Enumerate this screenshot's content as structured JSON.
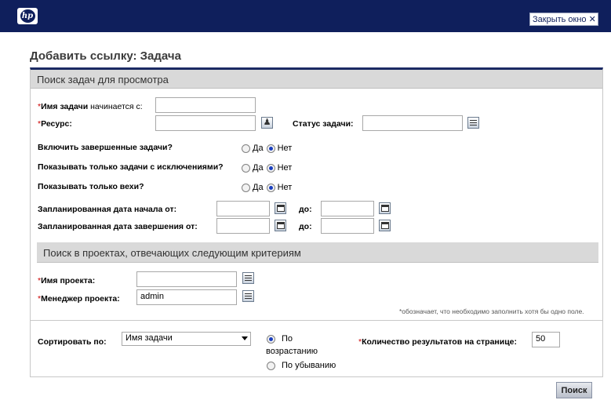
{
  "header": {
    "logo_text": "hp",
    "close_label": "Закрыть окно ✕"
  },
  "page_title": "Добавить ссылку: Задача",
  "section1": {
    "title": "Поиск задач для просмотра",
    "task_name_label": "Имя задачи",
    "task_name_suffix": " начинается с:",
    "task_name_value": "",
    "resource_label": "Ресурс:",
    "resource_value": "",
    "status_label": "Статус задачи:",
    "status_value": "",
    "include_completed_label": "Включить завершенные задачи?",
    "only_exceptions_label": "Показывать только задачи с исключениями?",
    "only_milestones_label": "Показывать только вехи?",
    "yes": "Да",
    "no": "Нет",
    "planned_start_label": "Запланированная дата начала от:",
    "planned_end_label": "Запланированная дата завершения от:",
    "to_label": "до:"
  },
  "section2": {
    "title": "Поиск в проектах, отвечающих следующим критериям",
    "project_name_label": "Имя проекта:",
    "project_name_value": "",
    "project_manager_label": "Менеджер проекта:",
    "project_manager_value": "admin",
    "note": "*обозначает, что необходимо заполнить хотя бы одно поле."
  },
  "sort": {
    "sort_by_label": "Сортировать по:",
    "sort_by_value": "Имя задачи",
    "ascending_line1": "По",
    "ascending_line2": "возрастанию",
    "descending": "По убыванию",
    "results_label": "Количество результатов на странице:",
    "results_value": "50"
  },
  "search_button": "Поиск",
  "required_mark": "*"
}
